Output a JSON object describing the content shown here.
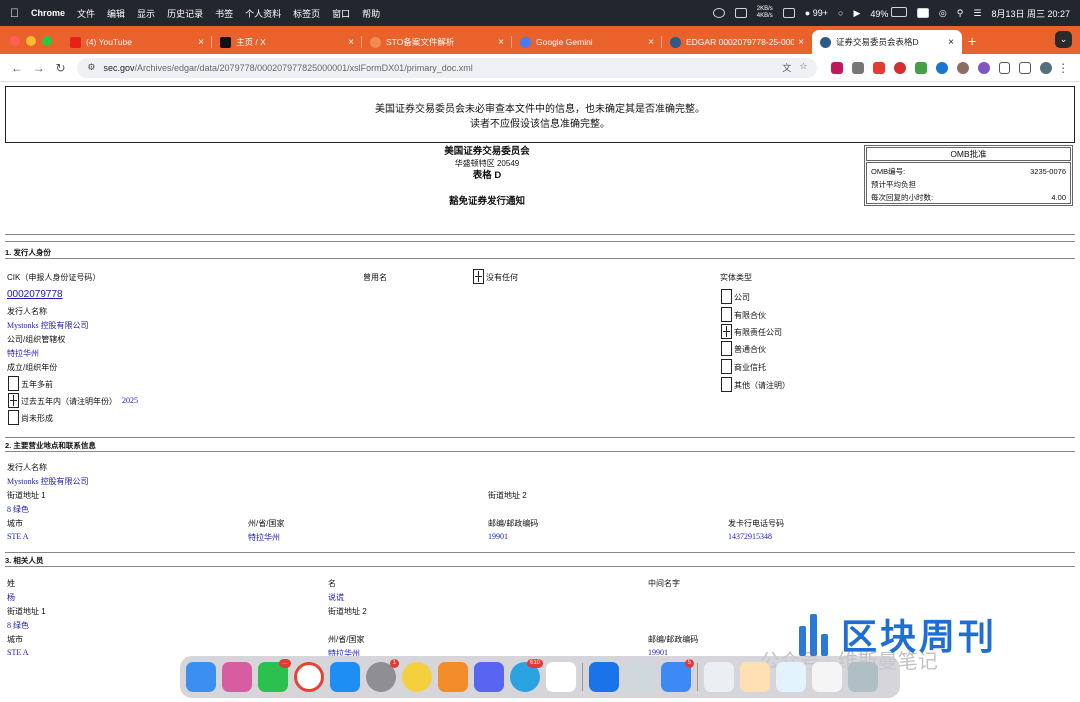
{
  "menubar": {
    "app": "Chrome",
    "menus": [
      "文件",
      "编辑",
      "显示",
      "历史记录",
      "书签",
      "个人资料",
      "标签页",
      "窗口",
      "帮助"
    ],
    "net_up": "2KB/s",
    "net_down": "4KB/s",
    "wechat_badge": "99+",
    "battery": "49%",
    "datetime": "8月13日 周三  20:27"
  },
  "tabs": [
    {
      "title": "(4) YouTube",
      "color": "#e62117"
    },
    {
      "title": "主页 / X",
      "color": "#111111"
    },
    {
      "title": "STO备案文件解析",
      "color": "#e25822"
    },
    {
      "title": "Google Gemini",
      "color": "#4a7cf0"
    },
    {
      "title": "EDGAR 0002079778-25-000",
      "color": "#2d5a87"
    },
    {
      "title": "证券交易委员会表格D",
      "color": "#2d5a87"
    }
  ],
  "url": {
    "host": "sec.gov",
    "path": "/Archives/edgar/data/2079778/000207977825000001/xslFormDX01/primary_doc.xml"
  },
  "notice": {
    "line1": "美国证券交易委员会未必审查本文件中的信息，也未确定其是否准确完整。",
    "line2": "读者不应假设该信息准确完整。"
  },
  "omb": {
    "header": "OMB批准",
    "number_label": "OMB编号:",
    "number": "3235-0076",
    "burden_label": "预计平均负担",
    "hours_label": "每次回复的小时数:",
    "hours": "4.00"
  },
  "agency": {
    "name": "美国证券交易委员会",
    "address": "华盛顿特区 20549",
    "form": "表格 D",
    "subtitle": "豁免证券发行通知"
  },
  "section1": {
    "title": "1. 发行人身份",
    "cik_label": "CIK（申报人身份证号码）",
    "cik": "0002079778",
    "prior_name_label": "曾用名",
    "none_label": "没有任何",
    "entity_type_label": "实体类型",
    "issuer_name_label": "发行人名称",
    "issuer_name": "Mystonks 控股有限公司",
    "jurisdiction_label": "公司/组织管辖权",
    "jurisdiction": "特拉华州",
    "year_label": "成立/组织年份",
    "year_options": [
      "五年多前",
      "过去五年内（请注明年份）",
      "尚未形成"
    ],
    "year_value": "2025",
    "entity_types": [
      "公司",
      "有限合伙",
      "有限责任公司",
      "普通合伙",
      "商业信托",
      "其他（请注明）"
    ]
  },
  "section2": {
    "title": "2. 主要营业地点和联系信息",
    "issuer_name_label": "发行人名称",
    "issuer_name": "Mystonks 控股有限公司",
    "street1_label": "街道地址 1",
    "street1": "8 绿色",
    "street2_label": "街道地址 2",
    "city_label": "城市",
    "city": "STE A",
    "state_label": "州/省/国家",
    "state": "特拉华州",
    "zip_label": "邮编/邮政编码",
    "zip": "19901",
    "phone_label": "发卡行电话号码",
    "phone": "14372915348"
  },
  "section3": {
    "title": "3. 相关人员",
    "last_label": "姓",
    "last": "杨",
    "first_label": "名",
    "first": "说谎",
    "middle_label": "中间名字",
    "street1_label": "街道地址 1",
    "street1": "8 绿色",
    "street2_label": "街道地址 2",
    "city_label": "城市",
    "city": "STE A",
    "state_label": "州/省/国家",
    "state": "特拉华州",
    "zip_label": "邮编/邮政编码",
    "zip": "19901"
  },
  "dock": {
    "badges": {
      "wechat": "…",
      "settings": "1",
      "telegram": "610",
      "mail": "5"
    }
  },
  "watermark": {
    "text": "区块周刊",
    "sub": "公众号 · 维斯曼笔记"
  }
}
